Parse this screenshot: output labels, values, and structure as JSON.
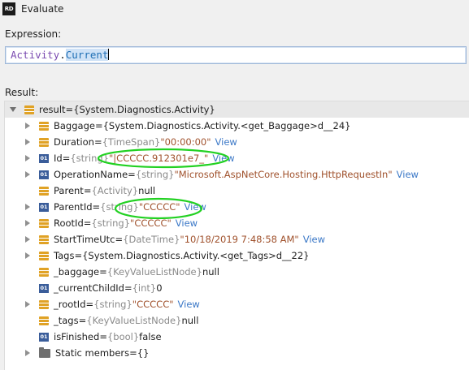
{
  "window": {
    "logo_text": "RD",
    "title": "Evaluate"
  },
  "expression": {
    "label": "Expression:",
    "type_token": "Activity",
    "dot": ".",
    "prop_token": "Current"
  },
  "result": {
    "label": "Result:",
    "root": {
      "name": "result",
      "eq": " = ",
      "value": "{System.Diagnostics.Activity}"
    },
    "rows": [
      {
        "name": "Baggage",
        "eq": " = ",
        "type": "",
        "value": "{System.Diagnostics.Activity.<get_Baggage>d__24}",
        "view": ""
      },
      {
        "name": "Duration",
        "eq": " = ",
        "type": "{TimeSpan}",
        "value": "\"00:00:00\"",
        "view": "View"
      },
      {
        "name": "Id",
        "eq": " = ",
        "type": "{string}",
        "value": "\"|CCCCC.912301e7_\"",
        "view": "View"
      },
      {
        "name": "OperationName",
        "eq": " = ",
        "type": "{string}",
        "value": "\"Microsoft.AspNetCore.Hosting.HttpRequestIn\"",
        "view": "View"
      },
      {
        "name": "Parent",
        "eq": " = ",
        "type": "{Activity}",
        "value": "null",
        "view": ""
      },
      {
        "name": "ParentId",
        "eq": " = ",
        "type": "{string}",
        "value": "\"CCCCC\"",
        "view": "View"
      },
      {
        "name": "RootId",
        "eq": " = ",
        "type": "{string}",
        "value": "\"CCCCC\"",
        "view": "View"
      },
      {
        "name": "StartTimeUtc",
        "eq": " = ",
        "type": "{DateTime}",
        "value": "\"10/18/2019 7:48:58 AM\"",
        "view": "View"
      },
      {
        "name": "Tags",
        "eq": " = ",
        "type": "",
        "value": "{System.Diagnostics.Activity.<get_Tags>d__22}",
        "view": ""
      },
      {
        "name": "_baggage",
        "eq": " = ",
        "type": "{KeyValueListNode}",
        "value": "null",
        "view": ""
      },
      {
        "name": "_currentChildId",
        "eq": " = ",
        "type": "{int}",
        "value": "0",
        "view": ""
      },
      {
        "name": "_rootId",
        "eq": " = ",
        "type": "{string}",
        "value": "\"CCCCC\"",
        "view": "View"
      },
      {
        "name": "_tags",
        "eq": " = ",
        "type": "{KeyValueListNode}",
        "value": "null",
        "view": ""
      },
      {
        "name": "isFinished",
        "eq": " = ",
        "type": "{bool}",
        "value": "false",
        "view": ""
      },
      {
        "name": "Static members",
        "eq": " = ",
        "type": "",
        "value": "{}",
        "view": ""
      }
    ],
    "icon_prim_text": "01"
  },
  "icons": {
    "logo": "rider-logo",
    "object": "object-field-icon",
    "primitive": "primitive-field-icon",
    "folder": "folder-icon",
    "expand": "chevron-right-icon",
    "collapse": "chevron-down-icon"
  },
  "colors": {
    "highlight_marker": "#22d122",
    "view_link": "#3b78c7",
    "string_value": "#a0522d"
  }
}
